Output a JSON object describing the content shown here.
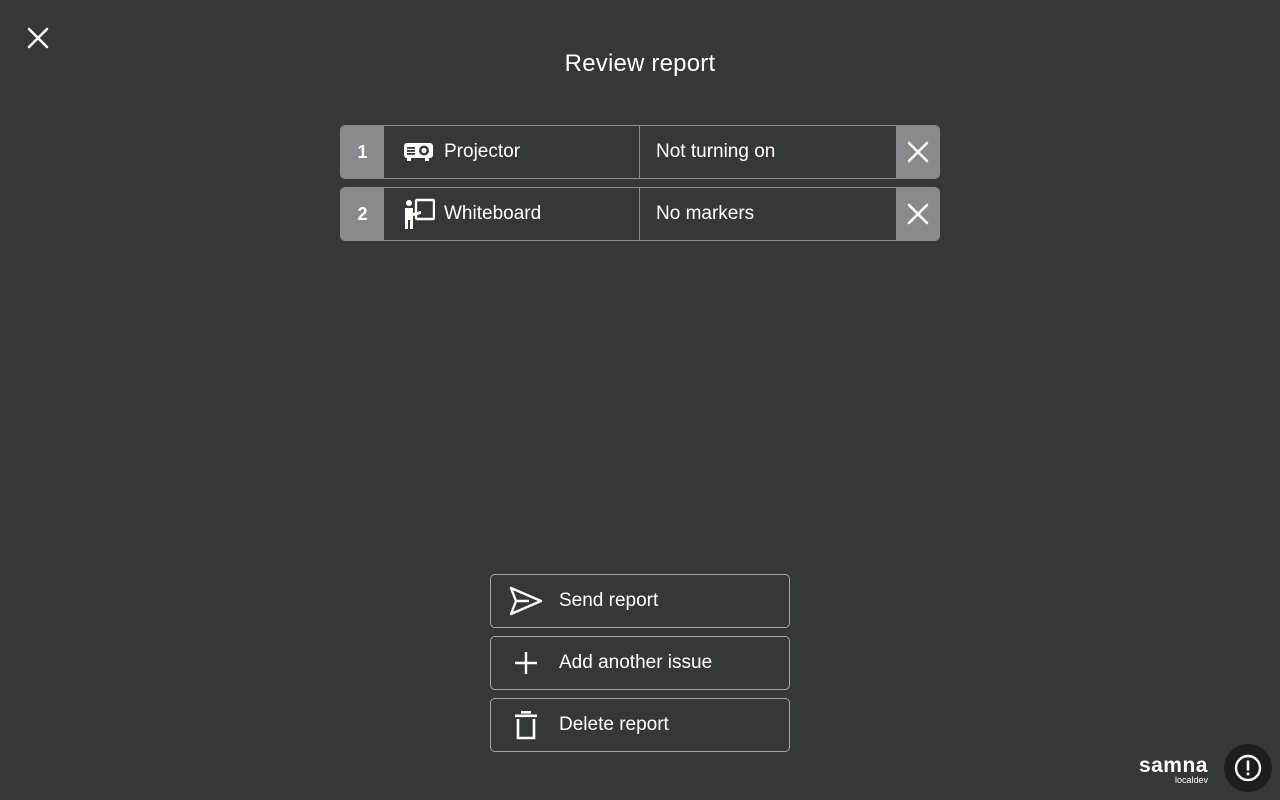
{
  "page": {
    "title": "Review report"
  },
  "header": {
    "close_icon": "close-icon"
  },
  "issues": [
    {
      "number": "1",
      "item_label": "Projector",
      "item_icon": "projector-icon",
      "problem": "Not turning on",
      "remove_icon": "close-icon"
    },
    {
      "number": "2",
      "item_label": "Whiteboard",
      "item_icon": "whiteboard-presenter-icon",
      "problem": "No markers",
      "remove_icon": "close-icon"
    }
  ],
  "actions": {
    "send": {
      "label": "Send report",
      "icon": "send-icon"
    },
    "add": {
      "label": "Add another issue",
      "icon": "plus-icon"
    },
    "delete": {
      "label": "Delete report",
      "icon": "trash-icon"
    }
  },
  "footer": {
    "brand_name": "samna",
    "brand_env": "localdev",
    "alert_icon": "alert-icon"
  },
  "colors": {
    "background": "#35373b",
    "badge_gray": "#8a8a8c",
    "border": "#8d8d8f",
    "text": "#ffffff",
    "alert_button_bg": "#1c1d20"
  }
}
